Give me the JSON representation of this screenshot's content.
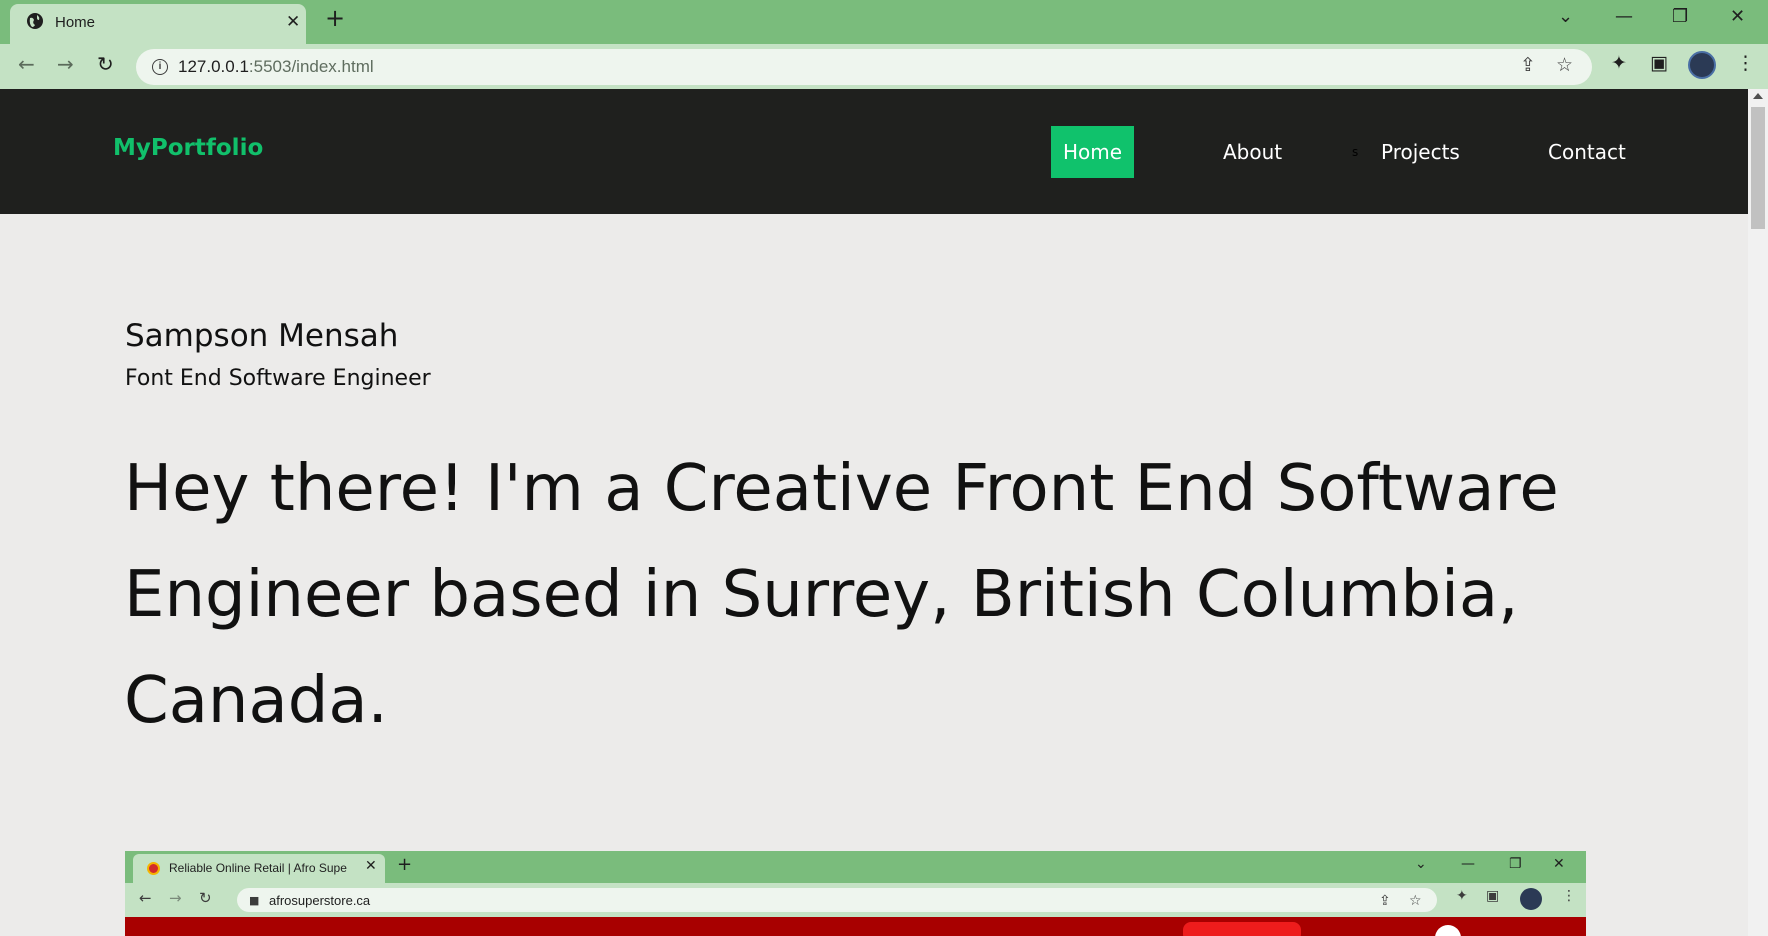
{
  "browser": {
    "tab_title": "Home",
    "tab_close": "✕",
    "new_tab": "+",
    "url_host": "127.0.0.1",
    "url_rest": ":5503/index.html",
    "controls": {
      "dropdown": "⌄",
      "minimize": "—",
      "restore": "❐",
      "close": "✕"
    }
  },
  "site": {
    "logo": "MyPortfolio",
    "nav": [
      {
        "label": "Home",
        "active": true
      },
      {
        "label": "About",
        "active": false
      },
      {
        "label": "Projects",
        "active": false
      },
      {
        "label": "Contact",
        "active": false
      }
    ],
    "stray_char": "s",
    "accent_color": "#10c26c",
    "nav_bg": "#1f201e"
  },
  "hero": {
    "name": "Sampson Mensah",
    "role": "Font End Software Engineer",
    "statement": "Hey there! I'm a Creative Front End Software Engineer based in Surrey, British Columbia, Canada."
  },
  "preview": {
    "tab_title": "Reliable Online Retail | Afro Supe",
    "url": "afrosuperstore.ca"
  }
}
